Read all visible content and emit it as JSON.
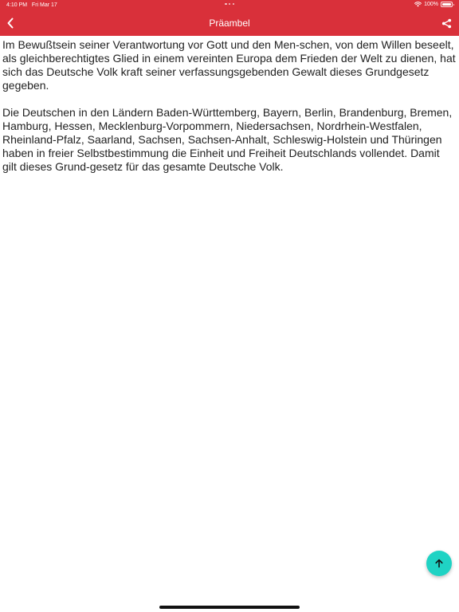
{
  "status_bar": {
    "time": "4:10 PM",
    "date": "Fri Mar 17",
    "battery": "100%"
  },
  "header": {
    "title": "Präambel",
    "back_icon": "chevron-left-icon",
    "share_icon": "share-icon"
  },
  "content": {
    "paragraphs": [
      "Im Bewußtsein seiner Verantwortung vor Gott und den Men-schen, von dem Willen beseelt, als gleichberechtigtes Glied in einem vereinten Europa dem Frieden der Welt zu dienen, hat sich das Deutsche Volk kraft seiner verfassungsgebenden Gewalt dieses Grundgesetz gegeben.",
      "Die Deutschen in den Ländern Baden-Württemberg, Bayern, Berlin, Brandenburg, Bremen, Hamburg, Hessen, Mecklenburg-Vorpommern, Niedersachsen, Nordrhein-Westfalen, Rheinland-Pfalz, Saarland, Sachsen, Sachsen-Anhalt, Schleswig-Holstein und Thüringen haben in freier Selbstbestimmung die Einheit und Freiheit Deutschlands vollendet. Damit gilt dieses Grund-gesetz für das gesamte Deutsche Volk."
    ]
  },
  "fab": {
    "icon": "arrow-up-icon"
  },
  "colors": {
    "header": "#d9303a",
    "fab": "#1fd3c4",
    "text": "#222222"
  }
}
